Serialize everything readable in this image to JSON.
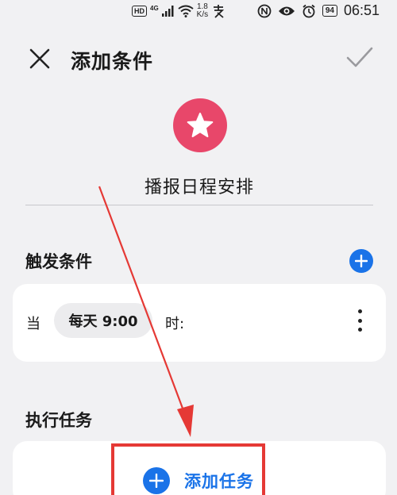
{
  "status_bar": {
    "hd": "HD",
    "network": "4G",
    "speed_value": "1.8",
    "speed_unit": "K/s",
    "battery": "94",
    "time": "06:51"
  },
  "header": {
    "title": "添加条件",
    "close_icon": "close-icon",
    "confirm_icon": "check-icon"
  },
  "scene": {
    "icon": "star-icon",
    "icon_color": "#e8476a",
    "name": "播报日程安排"
  },
  "trigger": {
    "section_title": "触发条件",
    "when_label": "当",
    "time_value": "每天 9:00",
    "at_label": "时:"
  },
  "tasks": {
    "section_title": "执行任务",
    "add_label": "添加任务"
  },
  "colors": {
    "accent": "#1a73e8",
    "highlight": "#e53935",
    "background": "#f1f1f3"
  }
}
